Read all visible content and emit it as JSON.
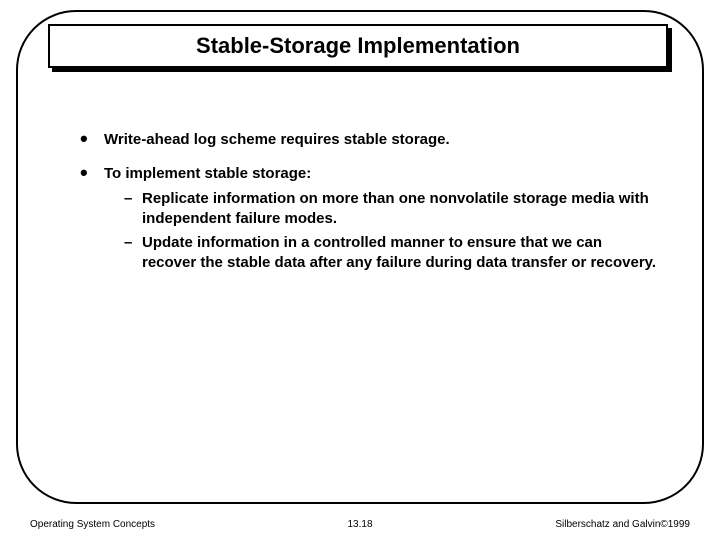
{
  "title": "Stable-Storage Implementation",
  "bullets": {
    "b1": "Write-ahead log scheme requires stable storage.",
    "b2": "To implement stable storage:",
    "b2_sub1": "Replicate information on more than one nonvolatile storage media with independent failure modes.",
    "b2_sub2": "Update information in a controlled manner to ensure that we can recover the stable data after any failure during data transfer or recovery."
  },
  "footer": {
    "left": "Operating System Concepts",
    "center": "13.18",
    "right": "Silberschatz and Galvin©1999"
  }
}
